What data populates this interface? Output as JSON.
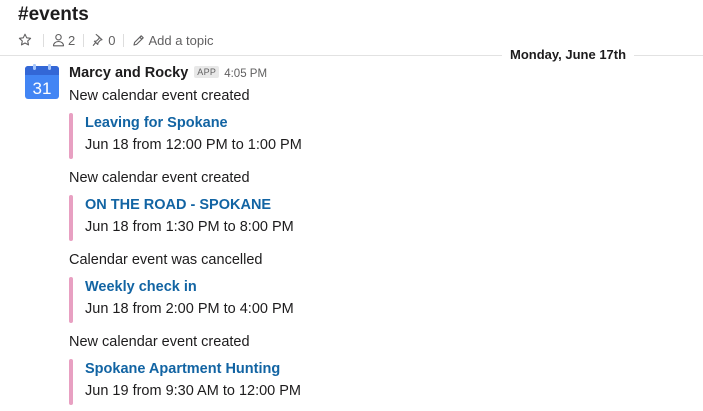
{
  "channel": {
    "name": "#events",
    "members_count": "2",
    "pins_count": "0",
    "add_topic_label": "Add a topic"
  },
  "date_divider": "Monday, June 17th",
  "message": {
    "sender": "Marcy and Rocky",
    "badge": "APP",
    "time": "4:05 PM",
    "avatar_day": "31",
    "entries": [
      {
        "text": "New calendar event created",
        "event_title": "Leaving for Spokane",
        "event_time": "Jun 18 from 12:00 PM to 1:00 PM"
      },
      {
        "text": "New calendar event created",
        "event_title": "ON THE ROAD - SPOKANE",
        "event_time": "Jun 18 from 1:30 PM to 8:00 PM"
      },
      {
        "text": "Calendar event was cancelled",
        "event_title": "Weekly check in",
        "event_time": "Jun 18 from 2:00 PM to 4:00 PM"
      },
      {
        "text": "New calendar event created",
        "event_title": "Spokane Apartment Hunting",
        "event_time": "Jun 19 from 9:30 AM to 12:00 PM"
      }
    ]
  },
  "colors": {
    "link": "#1264a3",
    "attachment_bar": "#e8a0c2",
    "calendar_blue": "#4285f4"
  }
}
